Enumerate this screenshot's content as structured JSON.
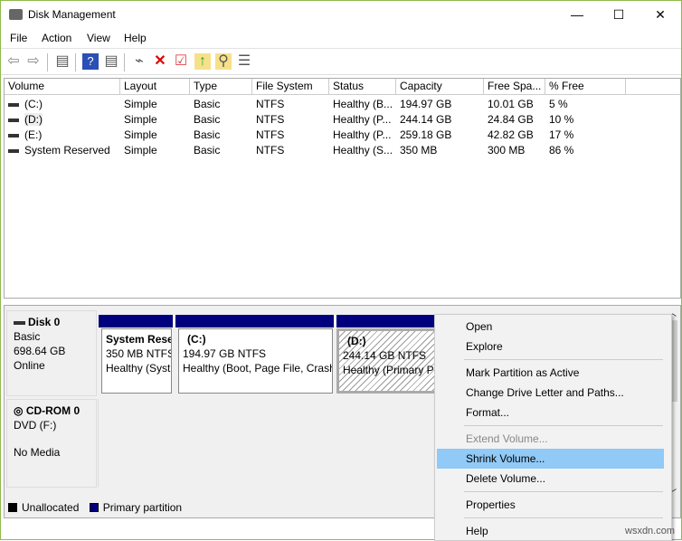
{
  "window": {
    "title": "Disk Management",
    "minimize": "—",
    "maximize": "☐",
    "close": "✕"
  },
  "menu": [
    "File",
    "Action",
    "View",
    "Help"
  ],
  "table": {
    "headers": [
      "Volume",
      "Layout",
      "Type",
      "File System",
      "Status",
      "Capacity",
      "Free Spa...",
      "% Free"
    ],
    "rows": [
      [
        "(C:)",
        "Simple",
        "Basic",
        "NTFS",
        "Healthy (B...",
        "194.97 GB",
        "10.01 GB",
        "5 %"
      ],
      [
        "(D:)",
        "Simple",
        "Basic",
        "NTFS",
        "Healthy (P...",
        "244.14 GB",
        "24.84 GB",
        "10 %"
      ],
      [
        "(E:)",
        "Simple",
        "Basic",
        "NTFS",
        "Healthy (P...",
        "259.18 GB",
        "42.82 GB",
        "17 %"
      ],
      [
        "System Reserved",
        "Simple",
        "Basic",
        "NTFS",
        "Healthy (S...",
        "350 MB",
        "300 MB",
        "86 %"
      ]
    ]
  },
  "disk0": {
    "name": "Disk 0",
    "type": "Basic",
    "size": "698.64 GB",
    "status": "Online",
    "partitions": [
      {
        "name": "System Rese",
        "size": "350 MB NTFS",
        "status": "Healthy (Syst"
      },
      {
        "name": "(C:)",
        "size": "194.97 GB NTFS",
        "status": "Healthy (Boot, Page File, Crash"
      },
      {
        "name": "(D:)",
        "size": "244.14 GB NTFS",
        "status": "Healthy (Primary Pa"
      }
    ]
  },
  "cdrom": {
    "name": "CD-ROM 0",
    "type": "DVD (F:)",
    "status": "No Media"
  },
  "legend": {
    "unallocated": "Unallocated",
    "primary": "Primary partition",
    "unallocated_color": "#000000",
    "primary_color": "#00007f"
  },
  "context_menu": {
    "open": "Open",
    "explore": "Explore",
    "mark_active": "Mark Partition as Active",
    "change_letter": "Change Drive Letter and Paths...",
    "format": "Format...",
    "extend": "Extend Volume...",
    "shrink": "Shrink Volume...",
    "delete": "Delete Volume...",
    "properties": "Properties",
    "help": "Help"
  },
  "watermark": "wsxdn.com"
}
